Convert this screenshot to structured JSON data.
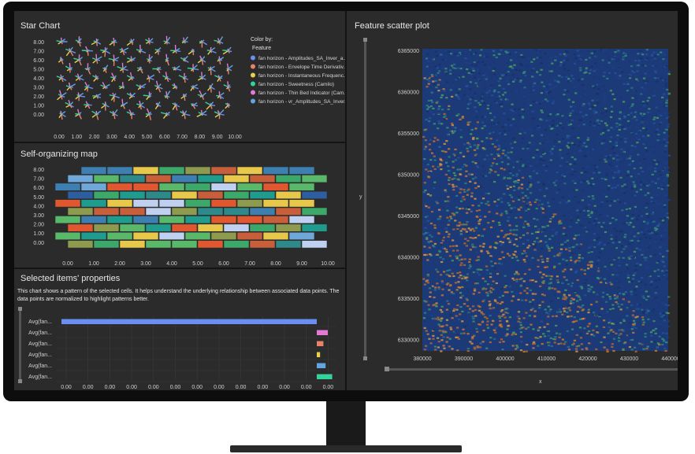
{
  "star_chart": {
    "title": "Star Chart",
    "x_ticks": [
      "0.00",
      "1.00",
      "2.00",
      "3.00",
      "4.00",
      "5.00",
      "6.00",
      "7.00",
      "8.00",
      "9.00",
      "10.00"
    ],
    "y_ticks": [
      "8.00",
      "7.00",
      "6.00",
      "5.00",
      "4.00",
      "3.00",
      "2.00",
      "1.00",
      "0.00"
    ],
    "legend": {
      "title": "Color by:",
      "subtitle": "Feature",
      "items": [
        {
          "label": "fan horizon - Amplitudes_SA_Inver_a...",
          "color": "#6b8ff0"
        },
        {
          "label": "fan horizon - Envelope Time Derivativ...",
          "color": "#e8826a"
        },
        {
          "label": "fan horizon - Instantaneous Frequenc...",
          "color": "#e8d24a"
        },
        {
          "label": "fan horizon - Sweetness (Camilo)",
          "color": "#34d39a"
        },
        {
          "label": "fan horizon - Thin Bed Indicator (Cam...",
          "color": "#e47ad6"
        },
        {
          "label": "fan horizon - vr_Amplitudes_SA_Inver...",
          "color": "#5fa6e3"
        }
      ]
    }
  },
  "som": {
    "title": "Self-organizing map",
    "x_ticks": [
      "0.00",
      "1.00",
      "2.00",
      "3.00",
      "4.00",
      "5.00",
      "6.00",
      "7.00",
      "8.00",
      "9.00",
      "10.00"
    ],
    "y_ticks": [
      "8.00",
      "7.00",
      "6.00",
      "5.00",
      "4.00",
      "3.00",
      "2.00",
      "1.00",
      "0.00"
    ],
    "palette": [
      "#3d7fb0",
      "#2e8a8a",
      "#3ca86a",
      "#e1572f",
      "#bfd0f0",
      "#e8c84a",
      "#8e9b4e",
      "#1f9c8e",
      "#2d5fa0",
      "#c95f3a",
      "#59b86a",
      "#6fa8d8"
    ]
  },
  "properties": {
    "title": "Selected items' properties",
    "description_line1": "This chart shows a pattern of the selected cells. It helps understand the underlying relationship between associated data points. The",
    "description_line2": "data points are normalized to highlight patterns better.",
    "rows": [
      {
        "label": "Avg(fan...",
        "value": -1.0,
        "color": "#6b8ff0"
      },
      {
        "label": "Avg(fan...",
        "value": 0.05,
        "color": "#e47ad6"
      },
      {
        "label": "Avg(fan...",
        "value": 0.03,
        "color": "#e8826a"
      },
      {
        "label": "Avg(fan...",
        "value": 0.015,
        "color": "#e8d24a"
      },
      {
        "label": "Avg(fan...",
        "value": 0.04,
        "color": "#5fa6e3"
      },
      {
        "label": "Avg(fan...",
        "value": 0.07,
        "color": "#34d39a"
      }
    ],
    "x_ticks": [
      "0.00",
      "0.00",
      "0.00",
      "0.00",
      "0.00",
      "0.00",
      "0.00",
      "0.00",
      "0.00",
      "0.00",
      "0.00",
      "0.00",
      "0.00"
    ]
  },
  "scatter": {
    "title": "Feature scatter plot",
    "x_label": "x",
    "y_label": "y",
    "x_ticks": [
      "380000",
      "390000",
      "400000",
      "410000",
      "420000",
      "430000",
      "440000"
    ],
    "y_ticks": [
      "6365000",
      "6360000",
      "6355000",
      "6350000",
      "6345000",
      "6340000",
      "6335000",
      "6330000"
    ]
  },
  "chart_data": [
    {
      "type": "bar",
      "title": "Selected items' properties",
      "categories": [
        "Avg(fan...",
        "Avg(fan...",
        "Avg(fan...",
        "Avg(fan...",
        "Avg(fan...",
        "Avg(fan..."
      ],
      "values": [
        -1.0,
        0.05,
        0.03,
        0.015,
        0.04,
        0.07
      ]
    },
    {
      "type": "scatter",
      "title": "Feature scatter plot",
      "xlabel": "x",
      "ylabel": "y",
      "xlim": [
        377000,
        441000
      ],
      "ylim": [
        6328000,
        6365000
      ]
    }
  ]
}
